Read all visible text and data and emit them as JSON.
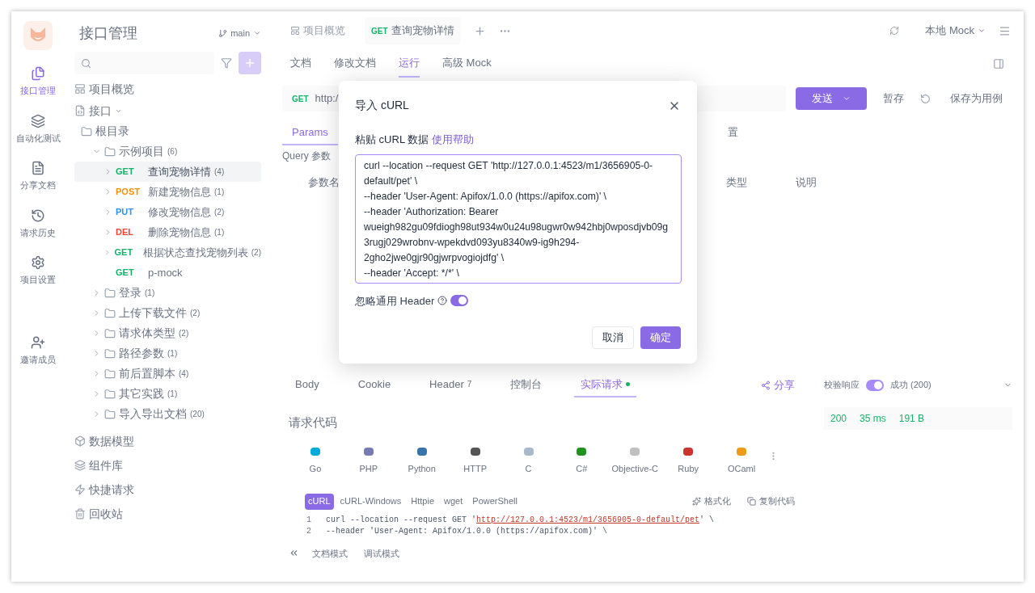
{
  "rail": {
    "items": [
      {
        "kind": "api",
        "label": "接口管理",
        "selected": true
      },
      {
        "kind": "test",
        "label": "自动化测试",
        "selected": false
      },
      {
        "kind": "doc",
        "label": "分享文档",
        "selected": false
      },
      {
        "kind": "history",
        "label": "请求历史",
        "selected": false
      },
      {
        "kind": "settings",
        "label": "项目设置",
        "selected": false
      },
      {
        "kind": "invite",
        "label": "邀请成员",
        "selected": false
      }
    ]
  },
  "sidebar": {
    "title": "接口管理",
    "branch": "main",
    "overview": "项目概览",
    "api_group": {
      "label": "接口",
      "expanded": true
    },
    "tree": [
      {
        "kind": "folder",
        "label": "根目录",
        "children": [
          {
            "kind": "folder",
            "label": "示例项目",
            "count": "(6)",
            "expanded": true,
            "children": [
              {
                "kind": "api",
                "method": "GET",
                "color": "#17b26a",
                "label": "查询宠物详情",
                "count": "(4)",
                "selected": true,
                "expandable": true
              },
              {
                "kind": "api",
                "method": "POST",
                "color": "#f79009",
                "label": "新建宠物信息",
                "count": "(1)",
                "selected": false,
                "expandable": true
              },
              {
                "kind": "api",
                "method": "PUT",
                "color": "#2e90fa",
                "label": "修改宠物信息",
                "count": "(2)",
                "selected": false,
                "expandable": true
              },
              {
                "kind": "api",
                "method": "DEL",
                "color": "#f04438",
                "label": "删除宠物信息",
                "count": "(1)",
                "selected": false,
                "expandable": true
              },
              {
                "kind": "api",
                "method": "GET",
                "color": "#17b26a",
                "label": "根据状态查找宠物列表",
                "count": "(2)",
                "selected": false,
                "expandable": true
              },
              {
                "kind": "api",
                "method": "GET",
                "color": "#17b26a",
                "label": "p-mock",
                "selected": false,
                "expandable": false
              }
            ]
          },
          {
            "kind": "folder",
            "label": "登录",
            "count": "(1)",
            "expanded": false
          },
          {
            "kind": "folder",
            "label": "上传下载文件",
            "count": "(2)",
            "expanded": false
          },
          {
            "kind": "folder",
            "label": "请求体类型",
            "count": "(2)",
            "expanded": false
          },
          {
            "kind": "folder",
            "label": "路径参数",
            "count": "(1)",
            "expanded": false
          },
          {
            "kind": "folder",
            "label": "前后置脚本",
            "count": "(4)",
            "expanded": false
          },
          {
            "kind": "folder",
            "label": "其它实践",
            "count": "(1)",
            "expanded": false
          },
          {
            "kind": "folder",
            "label": "导入导出文档",
            "count": "(20)",
            "expanded": false
          }
        ]
      }
    ],
    "sections": [
      {
        "kind": "model",
        "label": "数据模型"
      },
      {
        "kind": "components",
        "label": "组件库"
      },
      {
        "kind": "quick",
        "label": "快捷请求"
      },
      {
        "kind": "trash",
        "label": "回收站"
      }
    ]
  },
  "top_tabs": [
    {
      "kind": "overview",
      "label": "项目概览",
      "selected": false
    },
    {
      "kind": "api",
      "method": "GET",
      "label": "查询宠物详情",
      "selected": true
    }
  ],
  "environment": "本地 Mock",
  "sub_tabs": [
    {
      "label": "文档",
      "selected": false
    },
    {
      "label": "修改文档",
      "selected": false
    },
    {
      "label": "运行",
      "selected": true
    },
    {
      "label": "高级 Mock",
      "selected": false
    }
  ],
  "request": {
    "method": "GET",
    "url": "http:/",
    "send": "发送",
    "save_draft": "暂存",
    "save_case": "保存为用例"
  },
  "param_tabs": [
    {
      "label": "Params",
      "selected": true
    },
    {
      "label": "置",
      "selected": false
    }
  ],
  "query_title": "Query 参数",
  "param_columns": [
    "参数名",
    "类型",
    "说明"
  ],
  "response_tabs": [
    {
      "label": "Body",
      "selected": false
    },
    {
      "label": "Cookie",
      "selected": false
    },
    {
      "label": "Header",
      "count": "7",
      "selected": false
    },
    {
      "label": "控制台",
      "selected": false
    },
    {
      "label": "实际请求",
      "selected": true,
      "dot": true
    }
  ],
  "share": "分享",
  "code_title": "请求代码",
  "languages": [
    {
      "label": "Go",
      "color": "#00add8"
    },
    {
      "label": "PHP",
      "color": "#777bb3"
    },
    {
      "label": "Python",
      "color": "#3776ab"
    },
    {
      "label": "HTTP",
      "color": "#555555"
    },
    {
      "label": "C",
      "color": "#a8b9cc"
    },
    {
      "label": "C#",
      "color": "#239120"
    },
    {
      "label": "Objective-C",
      "color": "#c0c0c0"
    },
    {
      "label": "Ruby",
      "color": "#cc342d"
    },
    {
      "label": "OCaml",
      "color": "#ee9a1a"
    }
  ],
  "variants": [
    {
      "label": "cURL",
      "selected": true
    },
    {
      "label": "cURL-Windows",
      "selected": false
    },
    {
      "label": "Httpie",
      "selected": false
    },
    {
      "label": "wget",
      "selected": false
    },
    {
      "label": "PowerShell",
      "selected": false
    }
  ],
  "code_actions": [
    "格式化",
    "复制代码"
  ],
  "code_lines": [
    {
      "number": "1",
      "before": "curl --location --request GET '",
      "url": "http://127.0.0.1:4523/m1/3656905-0-default/pet",
      "after": "' \\"
    },
    {
      "number": "2",
      "before": "--header 'User-Agent: Apifox/1.0.0 (https://apifox.com)' \\"
    }
  ],
  "modes": [
    "文档模式",
    "调试模式"
  ],
  "validation": {
    "label": "校验响应",
    "on": true,
    "result": "成功 (200)"
  },
  "stats": [
    "200",
    "35 ms",
    "191 B"
  ],
  "dialog": {
    "title": "导入 cURL",
    "label": "粘贴 cURL 数据",
    "help": "使用帮助",
    "value": "curl --location --request GET 'http://127.0.0.1:4523/m1/3656905-0-default/pet' \\\n--header 'User-Agent: Apifox/1.0.0 (https://apifox.com)' \\\n--header 'Authorization: Bearer wueigh982gu09fdiogh98ut934w0u24u98ugwr0w942hbj0wposdjvb09g3rugj029wrobnv-wpekdvd093yu8340w9-ig9h294-2gho2jwe0gjr90gjwrpvogiojdfg' \\\n--header 'Accept: */*' \\",
    "ignore_header": {
      "label": "忽略通用 Header",
      "on": true
    },
    "cancel": "取消",
    "ok": "确定"
  }
}
